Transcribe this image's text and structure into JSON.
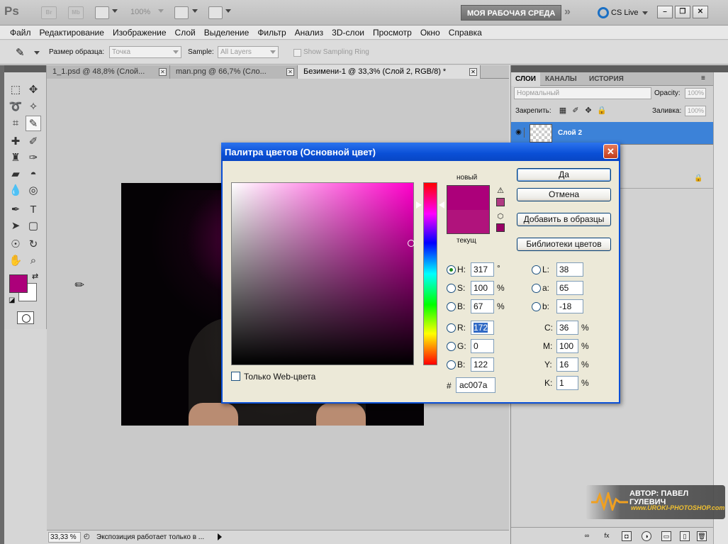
{
  "titlebar": {
    "logo": "Ps",
    "icon_br": "Br",
    "icon_mb": "Mb",
    "zoom": "100%",
    "workspace_button": "МОЯ РАБОЧАЯ СРЕДА",
    "more": "»",
    "cs_live": "CS Live",
    "window_controls": [
      "–",
      "❐",
      "✕"
    ]
  },
  "menu": [
    "Файл",
    "Редактирование",
    "Изображение",
    "Слой",
    "Выделение",
    "Фильтр",
    "Анализ",
    "3D-слои",
    "Просмотр",
    "Окно",
    "Справка"
  ],
  "options": {
    "sample_size_label": "Размер образца:",
    "sample_size_value": "Точка",
    "sample_label": "Sample:",
    "sample_value": "All Layers",
    "sampling_ring_label": "Show Sampling Ring"
  },
  "doc_tabs": [
    {
      "label": "1_1.psd @ 48,8% (Слой..."
    },
    {
      "label": "man.png @ 66,7% (Сло..."
    },
    {
      "label": "Безимени-1 @ 33,3% (Слой 2, RGB/8) *"
    }
  ],
  "status": {
    "zoom": "33,33 %",
    "text": "Экспозиция работает только в ..."
  },
  "layers_panel": {
    "tabs": [
      "СЛОИ",
      "КАНАЛЫ",
      "ИСТОРИЯ"
    ],
    "blend_mode": "Нормальный",
    "opacity_label": "Opacity:",
    "opacity_value": "100%",
    "lock_label": "Закрепить:",
    "fill_label": "Заливка:",
    "fill_value": "100%",
    "layer_name": "Слой 2"
  },
  "watermark": {
    "author": "АВТОР: ПАВЕЛ ГУЛЕВИЧ",
    "site": "www.UROKI-PHOTOSHOP.com"
  },
  "colors": {
    "foreground": "#ac007a",
    "background": "#ffffff",
    "new_color": "#ac007a",
    "current_color": "#b0137c",
    "accent": "#0a4fd6"
  },
  "color_picker": {
    "title": "Палитра цветов (Основной цвет)",
    "close": "✕",
    "new_label": "новый",
    "current_label": "текущ",
    "buttons": {
      "ok": "Да",
      "cancel": "Отмена",
      "add_swatches": "Добавить в образцы",
      "libraries": "Библиотеки цветов"
    },
    "web_only_label": "Только Web-цвета",
    "hsb": [
      {
        "label": "H:",
        "value": "317",
        "unit": "°"
      },
      {
        "label": "S:",
        "value": "100",
        "unit": "%"
      },
      {
        "label": "B:",
        "value": "67",
        "unit": "%"
      }
    ],
    "rgb": [
      {
        "label": "R:",
        "value": "172"
      },
      {
        "label": "G:",
        "value": "0"
      },
      {
        "label": "B:",
        "value": "122"
      }
    ],
    "lab": [
      {
        "label": "L:",
        "value": "38"
      },
      {
        "label": "a:",
        "value": "65"
      },
      {
        "label": "b:",
        "value": "-18"
      }
    ],
    "cmyk": [
      {
        "label": "C:",
        "value": "36",
        "unit": "%"
      },
      {
        "label": "M:",
        "value": "100",
        "unit": "%"
      },
      {
        "label": "Y:",
        "value": "16",
        "unit": "%"
      },
      {
        "label": "K:",
        "value": "1",
        "unit": "%"
      }
    ],
    "hex_label": "#",
    "hex": "ac007a"
  }
}
